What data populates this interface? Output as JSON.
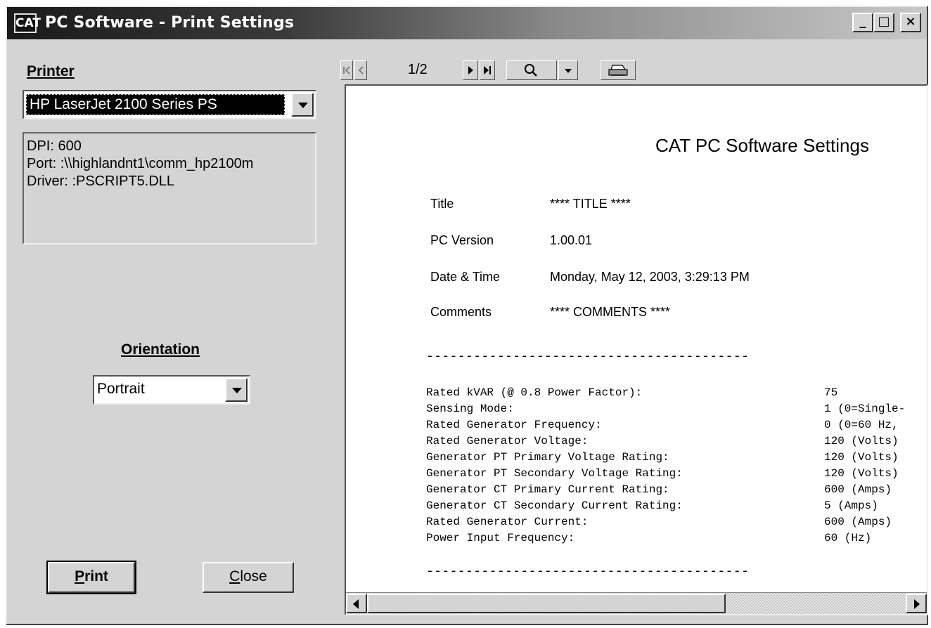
{
  "window": {
    "title": "PC Software - Print Settings",
    "logo_text": "CAT",
    "controls": {
      "minimize": "_",
      "maximize": "□",
      "close": "×"
    }
  },
  "printer": {
    "label": "Printer",
    "selected": "HP LaserJet 2100 Series PS",
    "info": [
      "DPI:  600",
      "Port: :\\\\highlandnt1\\comm_hp2100m",
      "Driver: :PSCRIPT5.DLL"
    ]
  },
  "orientation": {
    "label": "Orientation",
    "selected": "Portrait"
  },
  "buttons": {
    "print_mnemonic": "P",
    "print_rest": "rint",
    "close_mnemonic": "C",
    "close_rest": "lose"
  },
  "preview_toolbar": {
    "first_icon": "first-page-icon",
    "prev_icon": "prev-page-icon",
    "page_indicator": "1/2",
    "next_icon": "next-page-icon",
    "last_icon": "last-page-icon",
    "zoom_icon": "magnifier-icon",
    "zoom_dropdown_icon": "dropdown-icon",
    "print_icon": "printer-icon"
  },
  "document": {
    "title": "CAT PC Software Settings",
    "meta": [
      {
        "label": "Title",
        "value": "**** TITLE ****"
      },
      {
        "label": "PC Version",
        "value": "1.00.01"
      },
      {
        "label": "Date & Time",
        "value": "Monday, May 12, 2003, 3:29:13 PM"
      },
      {
        "label": "Comments",
        "value": "**** COMMENTS ****"
      }
    ],
    "separator": "-----------------------------------------",
    "settings": [
      {
        "name": "Rated kVAR (@ 0.8 Power Factor):",
        "value": "75"
      },
      {
        "name": "Sensing Mode:",
        "value": "1 (0=Single-"
      },
      {
        "name": "Rated Generator Frequency:",
        "value": "0 (0=60 Hz,"
      },
      {
        "name": "Rated Generator Voltage:",
        "value": "120 (Volts)"
      },
      {
        "name": "Generator PT Primary Voltage Rating:",
        "value": "120 (Volts)"
      },
      {
        "name": "Generator PT Secondary Voltage Rating:",
        "value": "120 (Volts)"
      },
      {
        "name": "Generator CT Primary Current Rating:",
        "value": "600 (Amps)"
      },
      {
        "name": "Generator CT Secondary Current Rating:",
        "value": "5 (Amps)"
      },
      {
        "name": "Rated Generator Current:",
        "value": "600 (Amps)"
      },
      {
        "name": "Power Input Frequency:",
        "value": "60 (Hz)"
      }
    ]
  }
}
